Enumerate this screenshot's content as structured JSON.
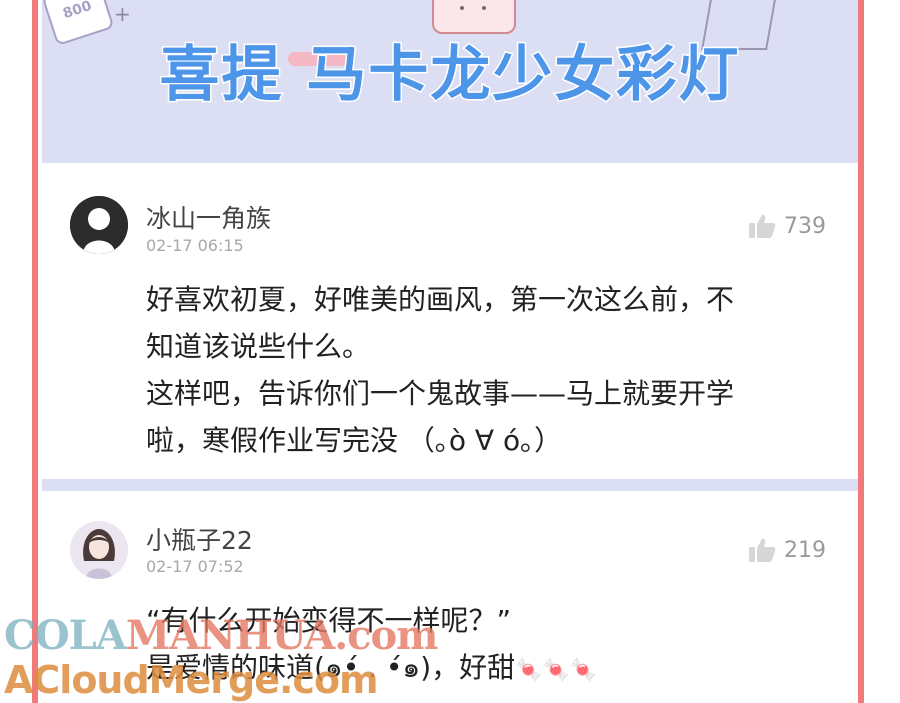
{
  "banner": {
    "title": "喜提  马卡龙少女彩灯"
  },
  "comments": [
    {
      "username": "冰山一角族",
      "time": "02-17 06:15",
      "likes": "739",
      "text": "好喜欢初夏，好唯美的画风，第一次这么前，不\n知道该说些什么。\n这样吧，告诉你们一个鬼故事——马上就要开学\n啦，寒假作业写完没 （｡ò ∀ ó｡）"
    },
    {
      "username": "小瓶子22",
      "time": "02-17 07:52",
      "likes": "219",
      "line1": "“有什么开始变得不一样呢？”",
      "line2": "是爱情的味道(๑•́ . •́๑)，好甜",
      "candies": "🍬🍬🍬"
    }
  ],
  "watermark": {
    "part1": "COLA",
    "part2": "MANHUA.com",
    "line2": "ACloudMerge.com"
  },
  "colors": {
    "frame": "#f07a7a",
    "banner_bg": "#dcdff4",
    "title": "#4d95e8"
  }
}
